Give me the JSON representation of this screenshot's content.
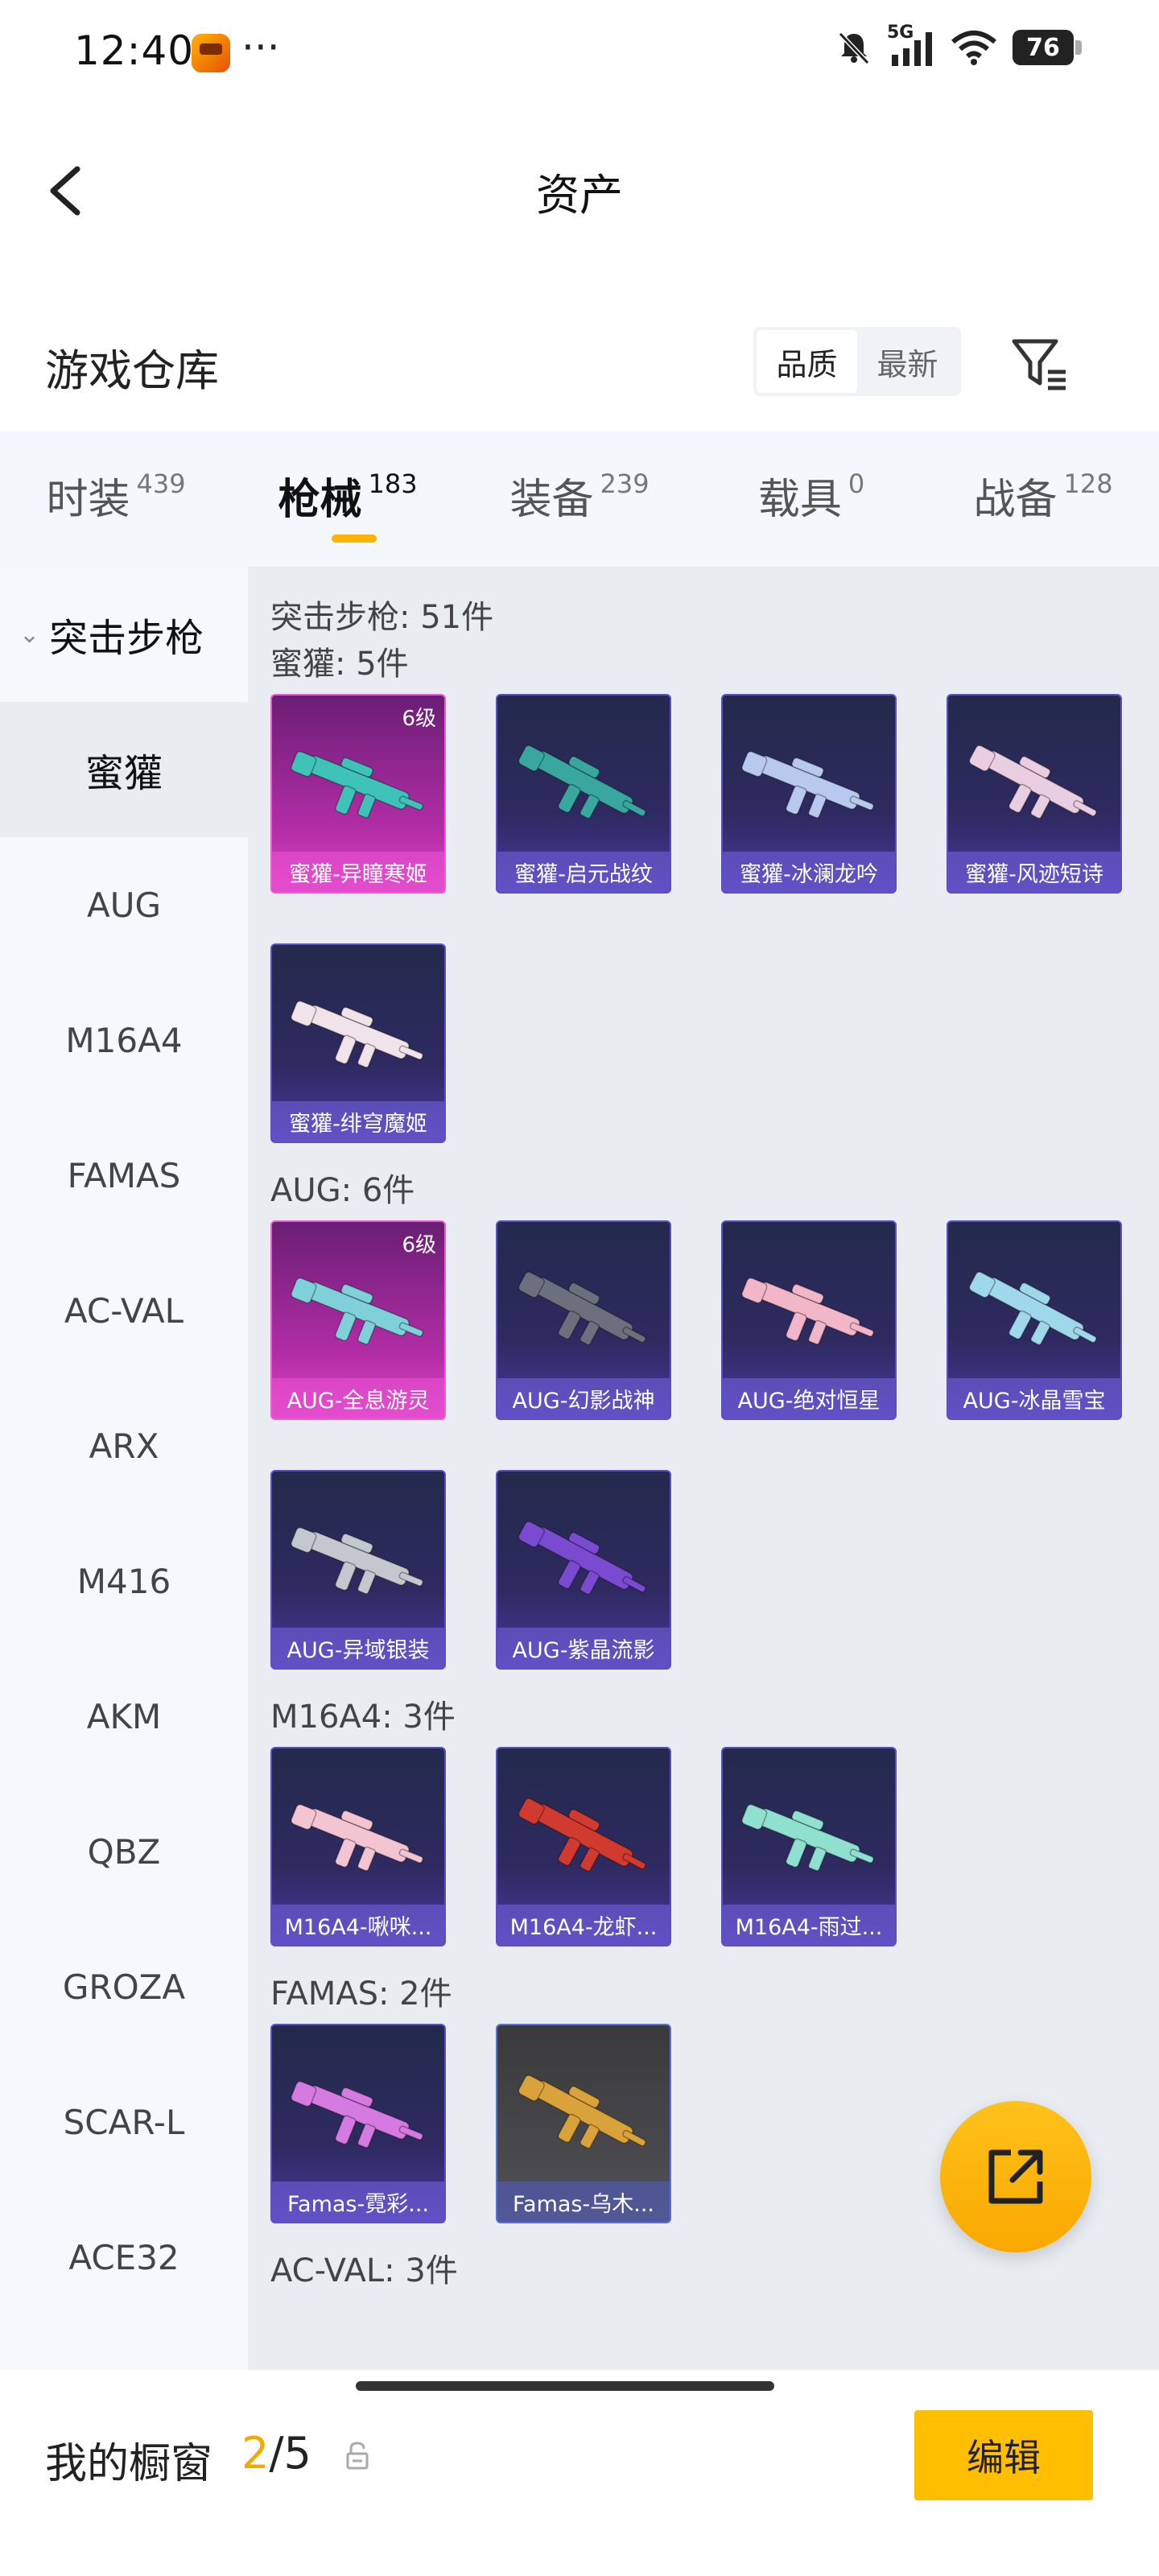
{
  "status_bar": {
    "time": "12:40",
    "dots": "···",
    "network": "5G",
    "battery": "76"
  },
  "header": {
    "title": "资产"
  },
  "subheader": {
    "title": "游戏仓库",
    "sort_options": [
      "品质",
      "最新"
    ],
    "active_sort": "品质"
  },
  "tabs": [
    {
      "label": "时装",
      "count": "439"
    },
    {
      "label": "枪械",
      "count": "183"
    },
    {
      "label": "装备",
      "count": "239"
    },
    {
      "label": "载具",
      "count": "0"
    },
    {
      "label": "战备",
      "count": "128"
    }
  ],
  "active_tab": "枪械",
  "sidebar": {
    "category": "突击步枪",
    "items": [
      "蜜獾",
      "AUG",
      "M16A4",
      "FAMAS",
      "AC-VAL",
      "ARX",
      "M416",
      "AKM",
      "QBZ",
      "GROZA",
      "SCAR-L",
      "ACE32"
    ],
    "active_item": "蜜獾"
  },
  "main": {
    "total": "突击步枪: 51件",
    "sections": [
      {
        "title": "蜜獾: 5件",
        "cards": [
          {
            "name": "蜜獾-异瞳寒姬",
            "level": "6级",
            "style": "pink",
            "gun_color": "#3fc2b8"
          },
          {
            "name": "蜜獾-启元战纹",
            "level": "",
            "style": "purple",
            "gun_color": "#3aa6a0"
          },
          {
            "name": "蜜獾-冰澜龙吟",
            "level": "",
            "style": "purple",
            "gun_color": "#b9c8ee"
          },
          {
            "name": "蜜獾-风迹短诗",
            "level": "",
            "style": "purple",
            "gun_color": "#e9cde0"
          },
          {
            "name": "蜜獾-绯穹魔姬",
            "level": "",
            "style": "purple",
            "gun_color": "#f1e3ea"
          }
        ]
      },
      {
        "title": "AUG: 6件",
        "cards": [
          {
            "name": "AUG-全息游灵",
            "level": "6级",
            "style": "pink",
            "gun_color": "#7fd0d8"
          },
          {
            "name": "AUG-幻影战神",
            "level": "",
            "style": "purple",
            "gun_color": "#6b6f7e"
          },
          {
            "name": "AUG-绝对恒星",
            "level": "",
            "style": "purple",
            "gun_color": "#f2b6c9"
          },
          {
            "name": "AUG-冰晶雪宝",
            "level": "",
            "style": "purple",
            "gun_color": "#9fd8ea"
          },
          {
            "name": "AUG-异域银装",
            "level": "",
            "style": "purple",
            "gun_color": "#c3c8cf"
          },
          {
            "name": "AUG-紫晶流影",
            "level": "",
            "style": "purple",
            "gun_color": "#7a4bd1"
          }
        ]
      },
      {
        "title": "M16A4: 3件",
        "cards": [
          {
            "name": "M16A4-啾咪...",
            "level": "",
            "style": "purple",
            "gun_color": "#f3c4d2"
          },
          {
            "name": "M16A4-龙虾...",
            "level": "",
            "style": "purple",
            "gun_color": "#d13a2e"
          },
          {
            "name": "M16A4-雨过...",
            "level": "",
            "style": "purple",
            "gun_color": "#8fe0cf"
          }
        ]
      },
      {
        "title": "FAMAS: 2件",
        "cards": [
          {
            "name": "Famas-霓彩...",
            "level": "",
            "style": "purple",
            "gun_color": "#d57ae0"
          },
          {
            "name": "Famas-乌木...",
            "level": "",
            "style": "gray",
            "gun_color": "#d9a23a"
          }
        ]
      },
      {
        "title": "AC-VAL: 3件",
        "cards": []
      }
    ]
  },
  "bottom_bar": {
    "label": "我的橱窗",
    "current": "2",
    "total": "/5",
    "edit_label": "编辑"
  },
  "colors": {
    "accent": "#ffbe00",
    "highlight_text": "#f5a800"
  }
}
